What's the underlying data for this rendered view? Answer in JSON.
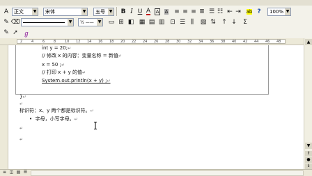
{
  "toolbar_formatting": {
    "style": "正文",
    "font": "宋体",
    "size": "五号",
    "bold": "B",
    "italic": "I",
    "underline": "U",
    "char_a": "A",
    "zoom": "100%"
  },
  "ruler": {
    "numbers": [
      "2",
      "4",
      "6",
      "8",
      "10",
      "12",
      "14",
      "16",
      "18",
      "20",
      "22",
      "24",
      "26",
      "28",
      "30",
      "32",
      "34",
      "36",
      "38",
      "40",
      "42",
      "44",
      "46",
      "48"
    ]
  },
  "document": {
    "lines": [
      "int y = 20;",
      "// 修改 x 的内容：变量名称 = 新值",
      "x = 50 ;",
      "// 打印 x + y 的值",
      "System.out.println(x + y) ;",
      "}",
      "标识符：x、y 两个都是标识符。",
      "字母，小写字母。"
    ],
    "bullet": "•"
  }
}
